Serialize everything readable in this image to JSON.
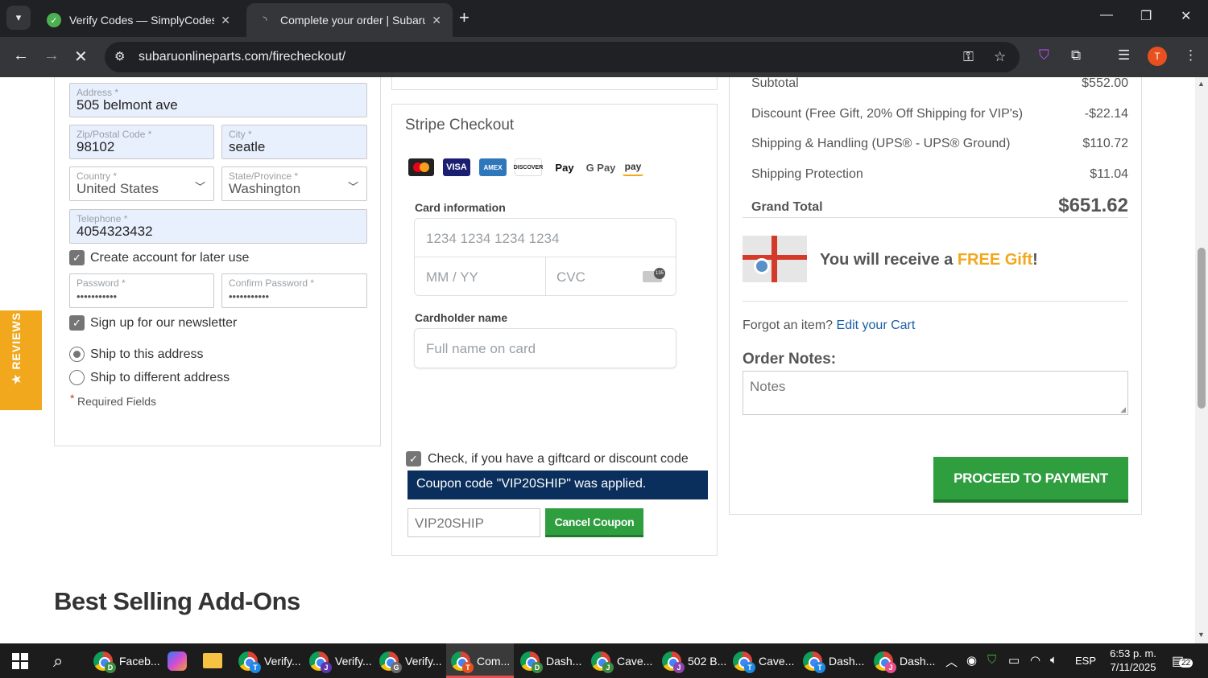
{
  "browser": {
    "tabs": [
      {
        "title": "Verify Codes — SimplyCodes",
        "active": false
      },
      {
        "title": "Complete your order | Subaru C",
        "active": true
      }
    ],
    "url": "subaruonlineparts.com/firecheckout/"
  },
  "billing": {
    "address": {
      "label": "Address *",
      "value": "505 belmont ave"
    },
    "zip": {
      "label": "Zip/Postal Code *",
      "value": "98102"
    },
    "city": {
      "label": "City *",
      "value": "seatle"
    },
    "country": {
      "label": "Country *",
      "value": "United States"
    },
    "state": {
      "label": "State/Province *",
      "value": "Washington"
    },
    "telephone": {
      "label": "Telephone *",
      "value": "4054323432"
    },
    "create_account": {
      "label": "Create account for later use",
      "checked": true
    },
    "password": {
      "label": "Password *",
      "value": "•••••••••••"
    },
    "confirm_password": {
      "label": "Confirm Password *",
      "value": "•••••••••••"
    },
    "newsletter": {
      "label": "Sign up for our newsletter",
      "checked": true
    },
    "ship_same": {
      "label": "Ship to this address",
      "selected": true
    },
    "ship_different": {
      "label": "Ship to different address",
      "selected": false
    },
    "required_note": "Required Fields",
    "required_star": "*"
  },
  "payment": {
    "title": "Stripe Checkout",
    "card_logos": [
      "MC",
      "VISA",
      "AMEX",
      "DISCOVER",
      "Pay",
      "G Pay",
      "pay"
    ],
    "card_info_label": "Card information",
    "card_number_placeholder": "1234 1234 1234 1234",
    "expiry_placeholder": "MM / YY",
    "cvc_placeholder": "CVC",
    "cvc_badge": "135",
    "cardholder_label": "Cardholder name",
    "cardholder_placeholder": "Full name on card",
    "coupon_check_label": "Check, if you have a giftcard or discount code",
    "coupon_message": "Coupon code \"VIP20SHIP\" was applied.",
    "coupon_value": "VIP20SHIP",
    "cancel_coupon": "Cancel Coupon"
  },
  "summary": {
    "rows": [
      {
        "label": "Subtotal",
        "value": "$552.00"
      },
      {
        "label": "Discount (Free Gift, 20% Off Shipping for VIP's)",
        "value": "-$22.14"
      },
      {
        "label": "Shipping & Handling (UPS® - UPS® Ground)",
        "value": "$110.72"
      },
      {
        "label": "Shipping Protection",
        "value": "$11.04"
      }
    ],
    "grand_total_label": "Grand Total",
    "grand_total_value": "$651.62",
    "gift_prefix": "You will receive a ",
    "gift_highlight": "FREE Gift",
    "gift_suffix": "!",
    "forgot_text": "Forgot an item?",
    "edit_cart": "Edit your Cart",
    "order_notes_label": "Order Notes:",
    "notes_placeholder": "Notes",
    "proceed_button": "PROCEED TO PAYMENT"
  },
  "addons_heading": "Best Selling Add-Ons",
  "reviews_tab": "★ REVIEWS",
  "taskbar": {
    "items": [
      {
        "label": "Faceb...",
        "badge": "D"
      },
      {
        "label": "Verify...",
        "badge": "T"
      },
      {
        "label": "Verify...",
        "badge": "J"
      },
      {
        "label": "Verify...",
        "badge": "G"
      },
      {
        "label": "Com...",
        "badge": "T"
      },
      {
        "label": "Dash...",
        "badge": "D"
      },
      {
        "label": "Cave...",
        "badge": "J"
      },
      {
        "label": "502 B...",
        "badge": "J"
      },
      {
        "label": "Cave...",
        "badge": "T"
      },
      {
        "label": "Dash...",
        "badge": "T"
      },
      {
        "label": "Dash...",
        "badge": "J"
      }
    ],
    "lang": "ESP",
    "time": "6:53 p. m.",
    "date": "7/11/2025",
    "notifications": "22"
  },
  "colors": {
    "brand_green": "#2f9e3f",
    "coupon_blue": "#0b2f5c",
    "gift_orange": "#f2a81d",
    "link_blue": "#1a5fa8",
    "reviews_orange": "#f2a81d"
  }
}
